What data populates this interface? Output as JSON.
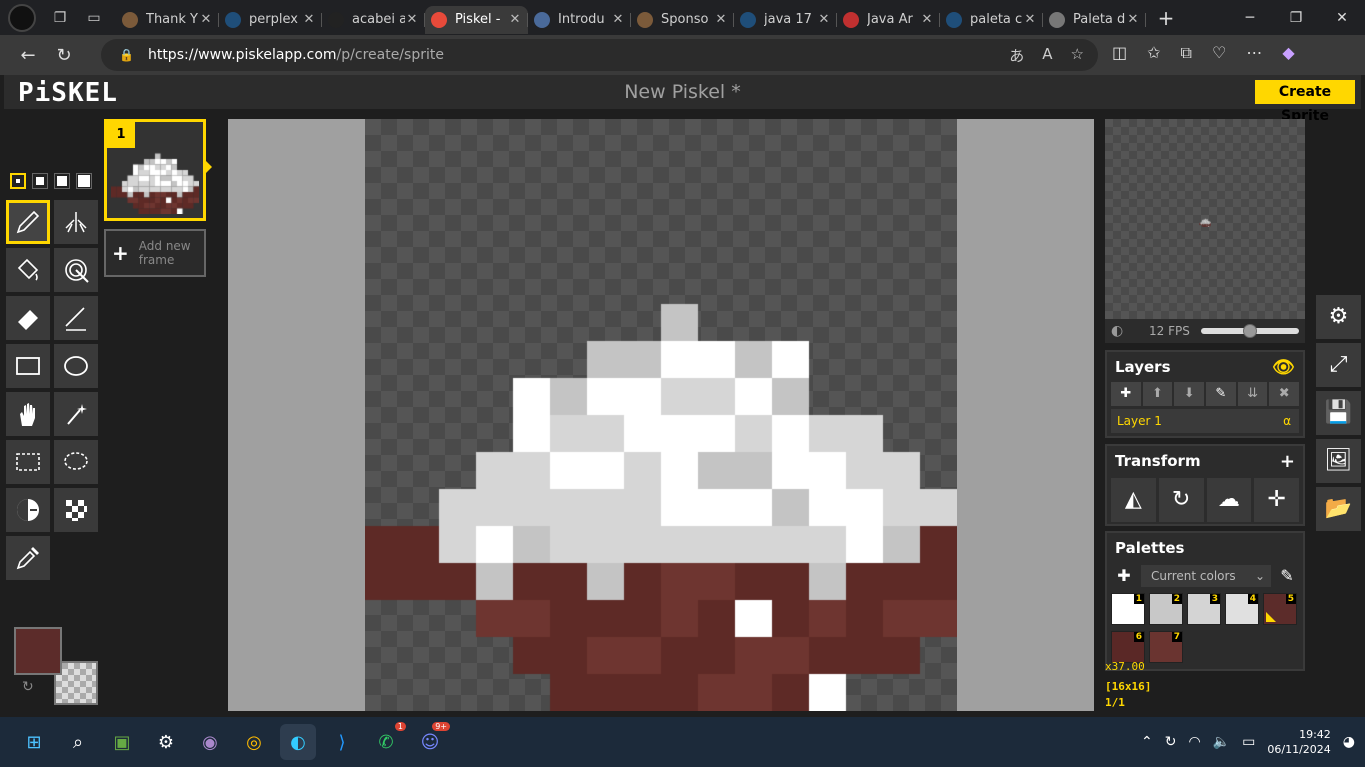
{
  "browser": {
    "tabs": [
      {
        "title": "Thank Y",
        "favicon": "#7b5a3a"
      },
      {
        "title": "perplex",
        "favicon": "#1f4e79"
      },
      {
        "title": "acabei a",
        "favicon": "#222222"
      },
      {
        "title": "Piskel -",
        "favicon": "#e84a3a",
        "active": true
      },
      {
        "title": "Introdu",
        "favicon": "#4a6a9a"
      },
      {
        "title": "Sponso",
        "favicon": "#7b5a3a"
      },
      {
        "title": "java 17",
        "favicon": "#1f4e79"
      },
      {
        "title": "Java Ar",
        "favicon": "#c03030"
      },
      {
        "title": "paleta c",
        "favicon": "#1f4e79"
      },
      {
        "title": "Paleta d",
        "favicon": "#777777"
      }
    ],
    "url_host": "https://www.piskelapp.com",
    "url_path": "/p/create/sprite"
  },
  "app": {
    "logo": "PiSKEL",
    "project_name": "New Piskel *",
    "create_button": "Create Sprite",
    "frame_number": "1",
    "add_frame_label": "Add new frame",
    "fps_label": "12 FPS",
    "fps_level": 0.5,
    "layers_title": "Layers",
    "layer_name": "Layer 1",
    "layer_alpha": "α",
    "transform_title": "Transform",
    "palettes_title": "Palettes",
    "palette_select": "Current colors",
    "zoom_label": "x37.00",
    "dims_label": "[16x16]",
    "frame_counter": "1/1",
    "primary_color": "#5c2c2a",
    "swatches": [
      {
        "n": "1",
        "color": "#ffffff"
      },
      {
        "n": "2",
        "color": "#c8c8c8"
      },
      {
        "n": "3",
        "color": "#d4d4d4"
      },
      {
        "n": "4",
        "color": "#e0e0e0"
      },
      {
        "n": "5",
        "color": "#5c2c2a",
        "selected": true
      },
      {
        "n": "6",
        "color": "#5a2826"
      },
      {
        "n": "7",
        "color": "#6a3430"
      }
    ]
  },
  "sprite": {
    "W": "#ffffff",
    "L": "#d6d6d6",
    "G": "#c4c4c4",
    "D": "#5e2a26",
    "R": "#6e3530",
    "rows": [
      "................",
      "................",
      "................",
      "................",
      "................",
      "........G.......",
      "......GGWWGW....",
      "....WGWWLLWG....",
      "....WLLWWWLWLL..",
      "...LLWWLWGGWWLL.",
      "..LLLLLLWWWGWWLL",
      "DDLWGLLLLLLLLWGD",
      "DDDGDDGDRRDDGDDD",
      "...RRDDDRDWDRDRR",
      "....DDRRDDRRDDD.",
      ".....DDDDRRDW..."
    ]
  },
  "taskbar": {
    "time": "19:42",
    "date": "06/11/2024"
  }
}
